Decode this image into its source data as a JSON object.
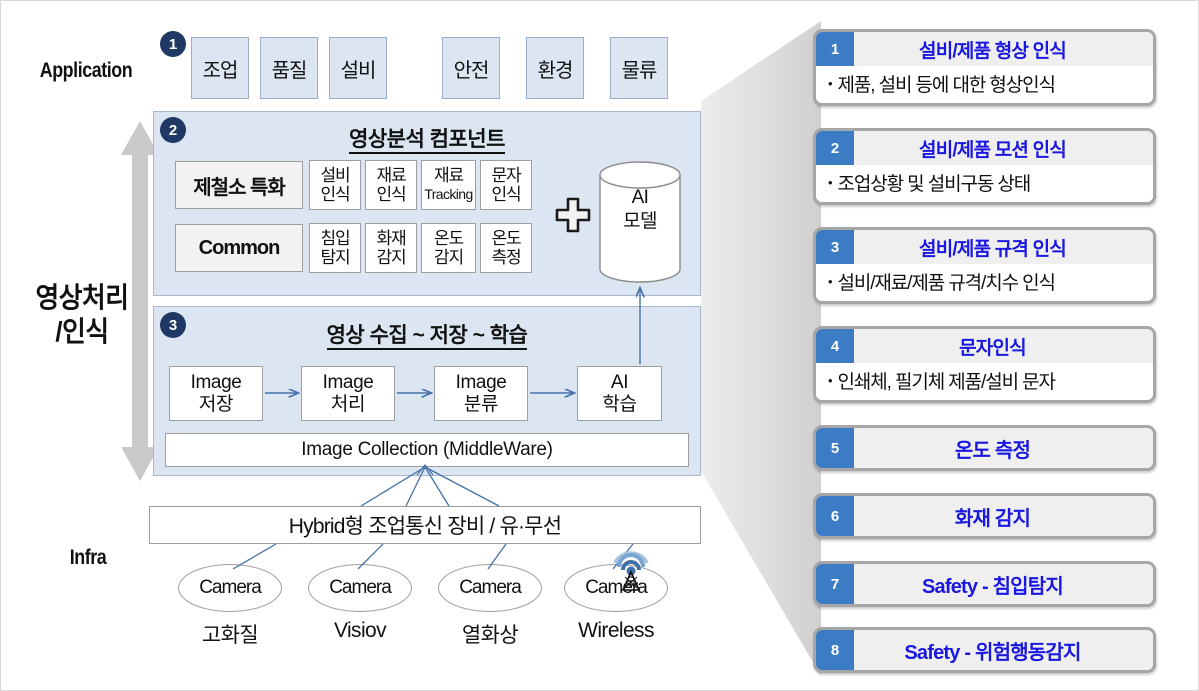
{
  "left_labels": {
    "application": "Application",
    "vision_line1": "영상처리",
    "vision_line2": "/인식",
    "infra": "Infra"
  },
  "application_tabs": [
    {
      "label": "조업"
    },
    {
      "label": "품질"
    },
    {
      "label": "설비"
    },
    {
      "label": "안전"
    },
    {
      "label": "환경"
    },
    {
      "label": "물류"
    }
  ],
  "markers": {
    "one": "1",
    "two": "2",
    "three": "3"
  },
  "panel2": {
    "title": "영상분석 컴포넌트",
    "rows": [
      {
        "category": "제철소 특화",
        "features": [
          {
            "line1": "설비",
            "line2": "인식",
            "small": false
          },
          {
            "line1": "재료",
            "line2": "인식",
            "small": false
          },
          {
            "line1": "재료",
            "line2": "Tracking",
            "small": true
          },
          {
            "line1": "문자",
            "line2": "인식",
            "small": false
          }
        ]
      },
      {
        "category": "Common",
        "features": [
          {
            "line1": "침입",
            "line2": "탐지",
            "small": false
          },
          {
            "line1": "화재",
            "line2": "감지",
            "small": false
          },
          {
            "line1": "온도",
            "line2": "감지",
            "small": false
          },
          {
            "line1": "온도",
            "line2": "측정",
            "small": false
          }
        ]
      }
    ],
    "plus_icon": "plus-icon",
    "ai_model": {
      "line1": "AI",
      "line2": "모델"
    }
  },
  "panel3": {
    "title": "영상 수집 ~ 저장 ~ 학습",
    "flow": [
      {
        "line1": "Image",
        "line2": "저장"
      },
      {
        "line1": "Image",
        "line2": "처리"
      },
      {
        "line1": "Image",
        "line2": "분류"
      },
      {
        "line1": "AI",
        "line2": "학습"
      }
    ],
    "middleware": "Image Collection (MiddleWare)"
  },
  "infra": {
    "hybrid_bar": "Hybrid형 조업통신 장비 / 유·무선",
    "cameras": [
      {
        "node": "Camera",
        "label": "고화질",
        "wireless": false
      },
      {
        "node": "Camera",
        "label": "Visiov",
        "wireless": false
      },
      {
        "node": "Camera",
        "label": "열화상",
        "wireless": false
      },
      {
        "node": "Camera",
        "label": "Wireless",
        "wireless": true
      }
    ]
  },
  "cards": [
    {
      "num": "1",
      "title": "설비/제품 형상 인식",
      "desc": "제품, 설비 등에 대한 형상인식"
    },
    {
      "num": "2",
      "title": "설비/제품 모션 인식",
      "desc": "조업상황 및 설비구동 상태"
    },
    {
      "num": "3",
      "title": "설비/제품 규격 인식",
      "desc": "설비/재료/제품 규격/치수 인식"
    },
    {
      "num": "4",
      "title": "문자인식",
      "desc": "인쇄체, 필기체 제품/설비 문자"
    },
    {
      "num": "5",
      "title": "온도 측정",
      "desc": null
    },
    {
      "num": "6",
      "title": "화재 감지",
      "desc": null
    },
    {
      "num": "7",
      "title": "Safety - 침입탐지",
      "desc": null
    },
    {
      "num": "8",
      "title": "Safety - 위험행동감지",
      "desc": null
    }
  ],
  "colors": {
    "panel_fill": "#dce6f2",
    "marker_navy": "#1f3864",
    "card_num_blue": "#3b7cc4",
    "card_title_blue": "#1a17e0",
    "wire_blue": "#4472a8",
    "wedge_grey": "#d9d9d9"
  },
  "bullet": "•"
}
